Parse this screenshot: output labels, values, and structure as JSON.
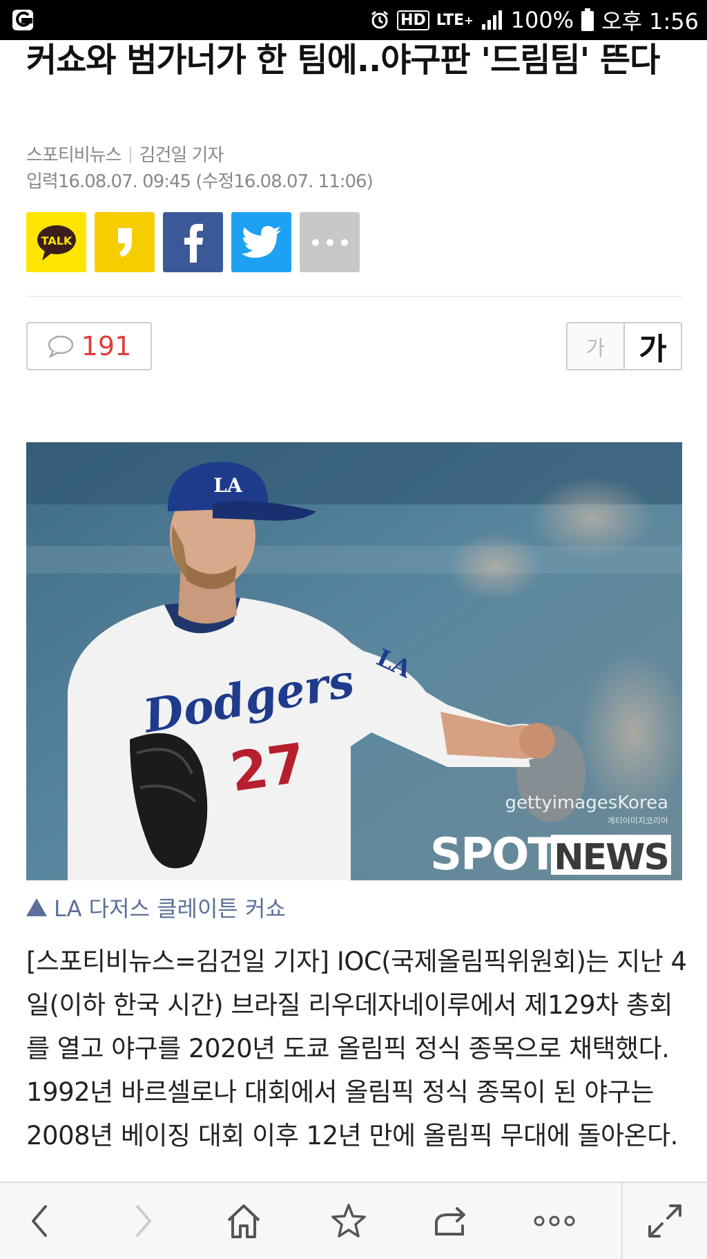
{
  "status_bar": {
    "battery_percent": "100%",
    "network": "LTE",
    "network_plus": "+",
    "hd": "HD",
    "time": "오후 1:56"
  },
  "article": {
    "headline": "커쇼와 범가너가 한 팀에..야구판 '드림팀' 뜬다",
    "source": "스포티비뉴스",
    "reporter": "김건일 기자",
    "timestamp": "입력16.08.07. 09:45 (수정16.08.07. 11:06)",
    "photo_caption": "LA 다저스 클레이튼 커쇼",
    "photo_watermark": "gettyimagesKorea",
    "photo_watermark_sub": "게티이미지코리아",
    "photo_brand_1": "SPOTV",
    "photo_brand_2": "NEWS",
    "jersey_text": "Dodgers",
    "jersey_number": "27",
    "cap_logo": "LA",
    "body": "[스포티비뉴스=김건일 기자] IOC(국제올림픽위원회)는 지난 4일(이하 한국 시간) 브라질 리우데자네이루에서 제129차 총회를 열고 야구를 2020년 도쿄 올림픽 정식 종목으로 채택했다. 1992년 바르셀로나 대회에서 올림픽 정식 종목이 된 야구는 2008년 베이징 대회 이후 12년 만에 올림픽 무대에 돌아온다."
  },
  "share": {
    "talk_label": "TALK",
    "icons": [
      "kakaotalk-icon",
      "kakaostory-icon",
      "facebook-icon",
      "twitter-icon",
      "more-icon"
    ]
  },
  "comments": {
    "count": "191"
  },
  "font_size": {
    "small_label": "가",
    "large_label": "가"
  },
  "colors": {
    "kakao_yellow": "#FEE500",
    "kakaostory_yellow": "#F6CD00",
    "facebook_blue": "#3B5998",
    "twitter_blue": "#1DA1F2",
    "more_gray": "#C8C8C8",
    "comment_red": "#E23B3B",
    "caption_blue": "#5A6F99"
  },
  "bottom_bar": {
    "icons": [
      "back-icon",
      "forward-icon",
      "home-icon",
      "bookmark-star-icon",
      "share-icon",
      "more-options-icon",
      "fullscreen-icon"
    ]
  }
}
